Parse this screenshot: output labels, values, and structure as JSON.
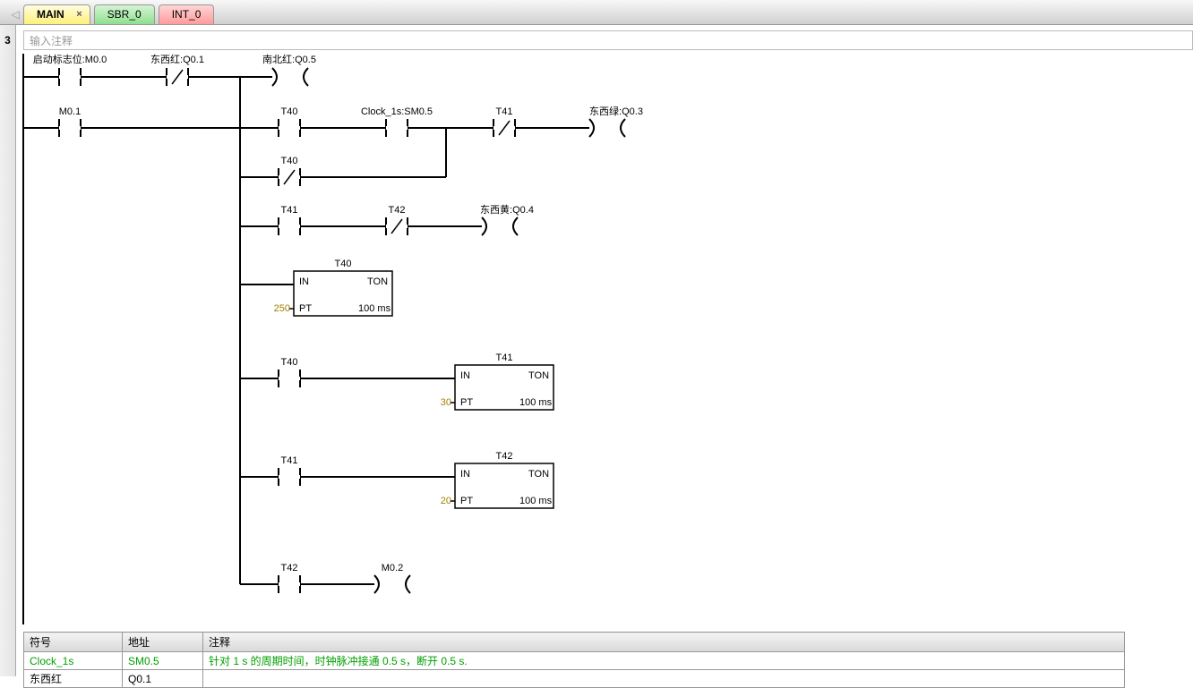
{
  "tabs": {
    "main": "MAIN",
    "sbr": "SBR_0",
    "int": "INT_0",
    "close": "×"
  },
  "network_number": "3",
  "comment_placeholder": "输入注释",
  "labels": {
    "start_flag": "启动标志位:M0.0",
    "ew_red": "东西红:Q0.1",
    "ns_red": "南北红:Q0.5",
    "m01": "M0.1",
    "t40": "T40",
    "clock1s": "Clock_1s:SM0.5",
    "t41": "T41",
    "ew_green": "东西绿:Q0.3",
    "t42": "T42",
    "ew_yellow": "东西黄:Q0.4",
    "m02": "M0.2",
    "in": "IN",
    "ton": "TON",
    "pt": "PT",
    "ms100": "100 ms",
    "pt250": "250",
    "pt30": "30",
    "pt20": "20"
  },
  "table": {
    "headers": {
      "symbol": "符号",
      "address": "地址",
      "comment": "注释"
    },
    "rows": [
      {
        "symbol": "Clock_1s",
        "address": "SM0.5",
        "comment": "针对 1 s 的周期时间，时钟脉冲接通 0.5 s，断开 0.5 s."
      },
      {
        "symbol": "东西红",
        "address": "Q0.1",
        "comment": ""
      }
    ]
  }
}
